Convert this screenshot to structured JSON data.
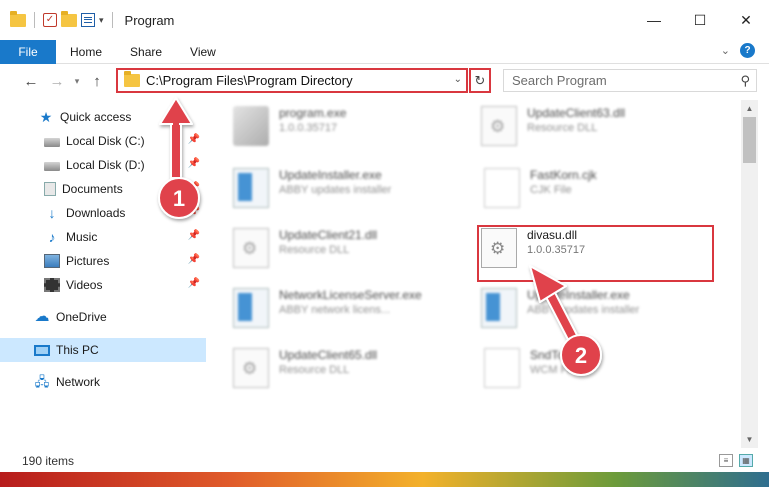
{
  "window": {
    "title": "Program",
    "controls": {
      "minimize": "—",
      "maximize": "☐",
      "close": "✕"
    }
  },
  "ribbon": {
    "file": "File",
    "tabs": [
      "Home",
      "Share",
      "View"
    ],
    "help": "?"
  },
  "address": {
    "path": "C:\\Program Files\\Program Directory",
    "search_placeholder": "Search Program"
  },
  "sidebar": {
    "items": [
      {
        "label": "Quick access",
        "icon": "star-icon",
        "pinned": false
      },
      {
        "label": "Local Disk (C:)",
        "icon": "disk-icon",
        "pinned": true
      },
      {
        "label": "Local Disk (D:)",
        "icon": "disk-icon",
        "pinned": true
      },
      {
        "label": "Documents",
        "icon": "documents-icon",
        "pinned": true
      },
      {
        "label": "Downloads",
        "icon": "download-icon",
        "pinned": true
      },
      {
        "label": "Music",
        "icon": "music-icon",
        "pinned": true
      },
      {
        "label": "Pictures",
        "icon": "pictures-icon",
        "pinned": true
      },
      {
        "label": "Videos",
        "icon": "videos-icon",
        "pinned": true
      },
      {
        "label": "OneDrive",
        "icon": "onedrive-icon",
        "pinned": false
      },
      {
        "label": "This PC",
        "icon": "pc-icon",
        "pinned": false,
        "selected": true
      },
      {
        "label": "Network",
        "icon": "network-icon",
        "pinned": false
      }
    ]
  },
  "files": [
    {
      "name": "program.exe",
      "desc": "1.0.0.35717",
      "icon": "program-icon"
    },
    {
      "name": "UpdateClient63.dll",
      "desc": "Resource DLL",
      "icon": "dll-icon"
    },
    {
      "name": "UpdateInstaller.exe",
      "desc": "ABBY updates installer",
      "icon": "exe-icon"
    },
    {
      "name": "FastKorn.cjk",
      "desc": "CJK File",
      "icon": "blank-file-icon"
    },
    {
      "name": "UpdateClient21.dll",
      "desc": "Resource DLL",
      "icon": "dll-icon"
    },
    {
      "name": "divasu.dll",
      "desc": "1.0.0.35717",
      "icon": "dll-icon"
    },
    {
      "name": "NetworkLicenseServer.exe",
      "desc": "ABBY network licens...",
      "icon": "exe-icon"
    },
    {
      "name": "UpdateInstaller.exe",
      "desc": "ABBY updates installer",
      "icon": "exe-icon"
    },
    {
      "name": "UpdateClient65.dll",
      "desc": "Resource DLL",
      "icon": "dll-icon"
    },
    {
      "name": "SndTo...wcm",
      "desc": "WCM File",
      "icon": "blank-file-icon"
    }
  ],
  "status": {
    "item_count": "190 items"
  },
  "annotations": {
    "step1": "1",
    "step2": "2"
  },
  "colors": {
    "accent": "#1979ca",
    "highlight": "#d9373f",
    "selection": "#cce8ff"
  }
}
